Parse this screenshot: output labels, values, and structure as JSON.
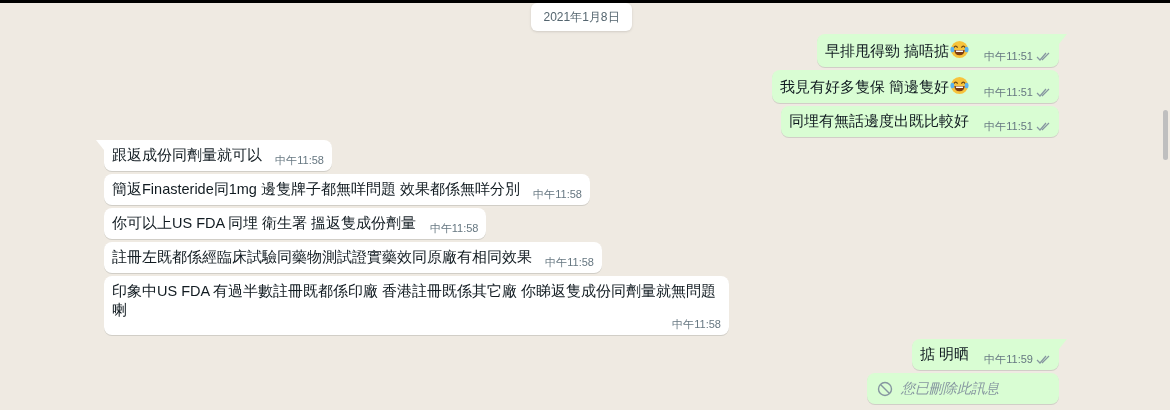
{
  "date_divider": "2021年1月8日",
  "messages": [
    {
      "kind": "text",
      "outgoing": true,
      "text": "早排甩得勁 搞唔掂",
      "emoji": true,
      "time": "中午11:51",
      "read": false,
      "tail": true
    },
    {
      "kind": "text",
      "outgoing": true,
      "text": "我見有好多隻保 簡邊隻好",
      "emoji": true,
      "time": "中午11:51",
      "read": false,
      "tail": false
    },
    {
      "kind": "text",
      "outgoing": true,
      "text": "同埋有無話邊度出既比較好",
      "emoji": false,
      "time": "中午11:51",
      "read": false,
      "tail": false
    },
    {
      "kind": "text",
      "outgoing": false,
      "text": "跟返成份同劑量就可以",
      "emoji": false,
      "time": "中午11:58",
      "tail": true
    },
    {
      "kind": "text",
      "outgoing": false,
      "text": "簡返Finasteride同1mg 邊隻牌子都無咩問題 效果都係無咩分別",
      "emoji": false,
      "time": "中午11:58",
      "tail": false
    },
    {
      "kind": "text",
      "outgoing": false,
      "text": "你可以上US FDA 同埋 衛生署 搵返隻成份劑量",
      "emoji": false,
      "time": "中午11:58",
      "tail": false
    },
    {
      "kind": "text",
      "outgoing": false,
      "text": "註冊左既都係經臨床試驗同藥物測試證實藥效同原廠有相同效果",
      "emoji": false,
      "time": "中午11:58",
      "tail": false
    },
    {
      "kind": "text",
      "outgoing": false,
      "text": "印象中US FDA 有過半數註冊既都係印廠 香港註冊既係其它廠 你睇返隻成份同劑量就無問題喇",
      "emoji": false,
      "time": "中午11:58",
      "tail": false
    },
    {
      "kind": "text",
      "outgoing": true,
      "text": "掂 明晒",
      "emoji": false,
      "time": "中午11:59",
      "read": false,
      "tail": true
    },
    {
      "kind": "deleted",
      "outgoing": true,
      "text": "您已刪除此訊息",
      "tail": false
    }
  ]
}
